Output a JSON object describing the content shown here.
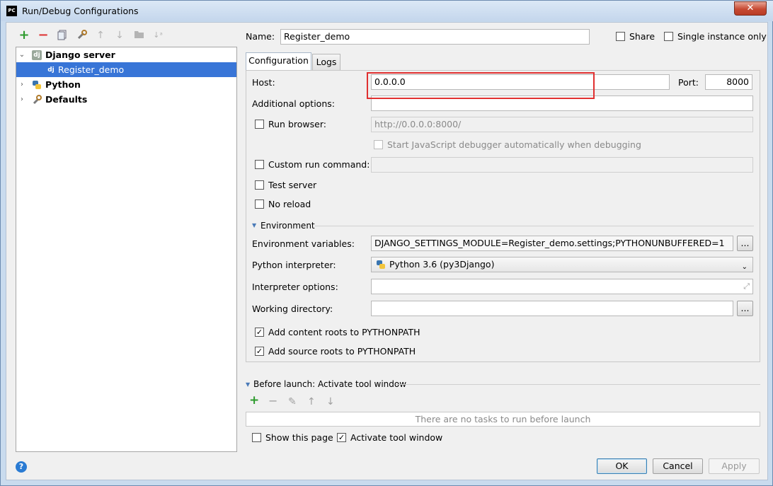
{
  "window": {
    "title": "Run/Debug Configurations",
    "app_icon_text": "PC",
    "close_symbol": "✕"
  },
  "toolbar": {
    "icons": [
      "add-icon",
      "remove-icon",
      "copy-icon",
      "wrench-icon",
      "move-up-icon",
      "move-down-icon",
      "folder-icon",
      "sort-icon"
    ]
  },
  "tree": {
    "items": [
      {
        "label": "Django server",
        "icon": "dj"
      },
      {
        "label": "Register_demo",
        "icon": "dj"
      },
      {
        "label": "Python"
      },
      {
        "label": "Defaults"
      }
    ]
  },
  "form": {
    "name_label": "Name:",
    "name_value": "Register_demo",
    "share_label": "Share",
    "single_instance_label": "Single instance only",
    "tabs": [
      "Configuration",
      "Logs"
    ],
    "host_label": "Host:",
    "host_value": "0.0.0.0",
    "port_label": "Port:",
    "port_value": "8000",
    "additional_options_label": "Additional options:",
    "run_browser_label": "Run browser:",
    "run_browser_url": "http://0.0.0.0:8000/",
    "js_debugger_label": "Start JavaScript debugger automatically when debugging",
    "custom_run_label": "Custom run command:",
    "test_server_label": "Test server",
    "no_reload_label": "No reload",
    "environment_section": "Environment",
    "env_vars_label": "Environment variables:",
    "env_vars_value": "DJANGO_SETTINGS_MODULE=Register_demo.settings;PYTHONUNBUFFERED=1",
    "python_interpreter_label": "Python interpreter:",
    "python_interpreter_value": "Python 3.6 (py3Django)",
    "interpreter_options_label": "Interpreter options:",
    "working_directory_label": "Working directory:",
    "browse_label": "...",
    "content_roots_label": "Add content roots to PYTHONPATH",
    "source_roots_label": "Add source roots to PYTHONPATH"
  },
  "before_launch": {
    "title": "Before launch: Activate tool window",
    "empty_text": "There are no tasks to run before launch",
    "show_page_label": "Show this page",
    "activate_tool_label": "Activate tool window"
  },
  "buttons": {
    "ok": "OK",
    "cancel": "Cancel",
    "apply": "Apply",
    "help": "?"
  }
}
